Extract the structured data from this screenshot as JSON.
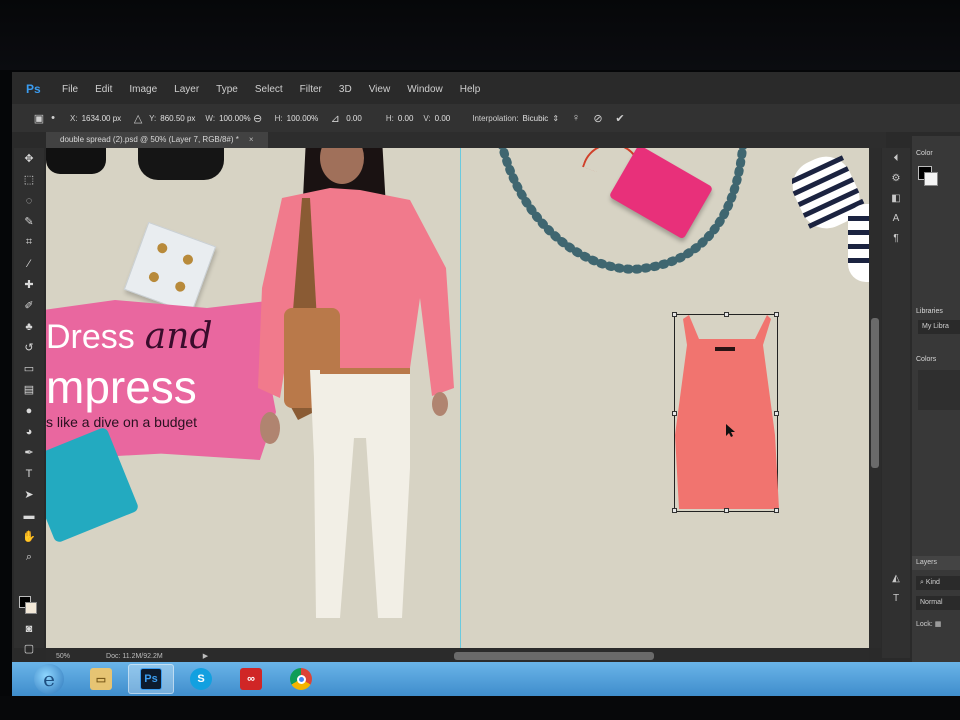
{
  "menu": {
    "logo": "Ps",
    "items": [
      "File",
      "Edit",
      "Image",
      "Layer",
      "Type",
      "Select",
      "Filter",
      "3D",
      "View",
      "Window",
      "Help"
    ]
  },
  "options": {
    "x_label": "X:",
    "x_value": "1634.00 px",
    "y_label": "Y:",
    "y_value": "860.50 px",
    "w_label": "W:",
    "w_value": "100.00%",
    "h_label": "H:",
    "h_value": "100.00%",
    "angle_value": "0.00",
    "hskew_label": "H:",
    "hskew_value": "0.00",
    "vskew_label": "V:",
    "vskew_value": "0.00",
    "interp_label": "Interpolation:",
    "interp_value": "Bicubic"
  },
  "document_tab": {
    "title": "double spread (2).psd @ 50% (Layer 7, RGB/8#) *",
    "close": "×"
  },
  "canvas_text": {
    "line1": "Dress",
    "line1_script": "and",
    "line2": "mpress",
    "line3": "s like a dive on a budget"
  },
  "status": {
    "zoom": "50%",
    "doc": "Doc: 11.2M/92.2M"
  },
  "panels": {
    "color_title": "Color",
    "libraries_title": "Libraries",
    "library_select": "My Libra",
    "colors_label": "Colors",
    "layers_tab": "Layers",
    "kind": "Kind",
    "blend_mode": "Normal",
    "lock_label": "Lock:"
  },
  "colors": {
    "accent": "#3b9cf0",
    "canvas_bg": "#d7d3c4",
    "banner_pink": "#e9679f",
    "top_coral": "#f1746f",
    "guide": "#4fc8e6"
  },
  "taskbar": {
    "apps": [
      "internet-explorer",
      "file-explorer",
      "photoshop",
      "skype",
      "creative-cloud",
      "chrome"
    ],
    "active": "photoshop"
  }
}
